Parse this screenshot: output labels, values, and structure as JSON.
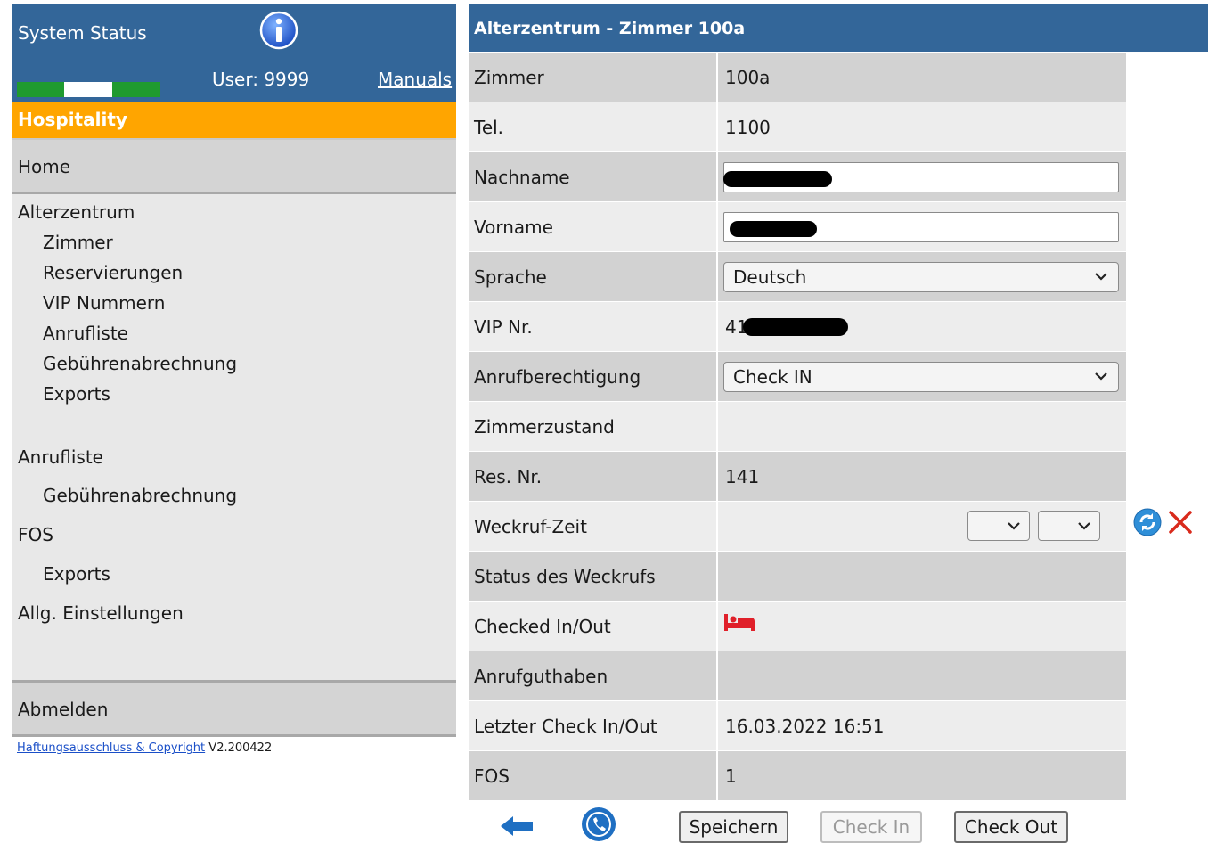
{
  "sidebar": {
    "system_status_label": "System Status",
    "user_label": "User: 9999",
    "manuals_label": "Manuals",
    "section_label": "Hospitality",
    "home_label": "Home",
    "groups": [
      {
        "label": "Alterzentrum",
        "items": [
          "Zimmer",
          "Reservierungen",
          "VIP Nummern",
          "Anrufliste",
          "Gebührenabrechnung",
          "Exports"
        ]
      },
      {
        "label": "Anrufliste",
        "items": [
          "Gebührenabrechnung"
        ]
      },
      {
        "label": "FOS",
        "items": [
          "Exports"
        ]
      },
      {
        "label": "Allg. Einstellungen",
        "items": []
      }
    ],
    "logout_label": "Abmelden",
    "footer_link": "Haftungsausschluss & Copyright",
    "version": "V2.200422"
  },
  "main": {
    "title": "Alterzentrum - Zimmer 100a",
    "rows": {
      "zimmer": {
        "label": "Zimmer",
        "value": "100a"
      },
      "tel": {
        "label": "Tel.",
        "value": "1100"
      },
      "nachname": {
        "label": "Nachname",
        "value": ""
      },
      "vorname": {
        "label": "Vorname",
        "value": ""
      },
      "sprache": {
        "label": "Sprache",
        "value": "Deutsch"
      },
      "vip": {
        "label": "VIP Nr.",
        "value": "41"
      },
      "anrufberechtigung": {
        "label": "Anrufberechtigung",
        "value": "Check IN"
      },
      "zimmerzustand": {
        "label": "Zimmerzustand",
        "value": ""
      },
      "res_nr": {
        "label": "Res. Nr.",
        "value": "141"
      },
      "weckruf_zeit": {
        "label": "Weckruf-Zeit",
        "value": ""
      },
      "weckruf_status": {
        "label": "Status des Weckrufs",
        "value": ""
      },
      "checked": {
        "label": "Checked In/Out",
        "value": ""
      },
      "anrufguthaben": {
        "label": "Anrufguthaben",
        "value": ""
      },
      "letzter": {
        "label": "Letzter Check In/Out",
        "value": "16.03.2022 16:51"
      },
      "fos": {
        "label": "FOS",
        "value": "1"
      }
    }
  },
  "toolbar": {
    "save_label": "Speichern",
    "checkin_label": "Check In",
    "checkout_label": "Check Out"
  },
  "icons": {
    "info": "info-icon",
    "back": "back-arrow-icon",
    "phone": "phone-icon",
    "refresh": "refresh-icon",
    "delete": "delete-x-icon",
    "bed": "bed-icon"
  },
  "colors": {
    "header_blue": "#336699",
    "section_orange": "#ffa500",
    "status_green": "#1f9a2f",
    "delete_red": "#d92a1c",
    "bed_red": "#e0202a"
  }
}
